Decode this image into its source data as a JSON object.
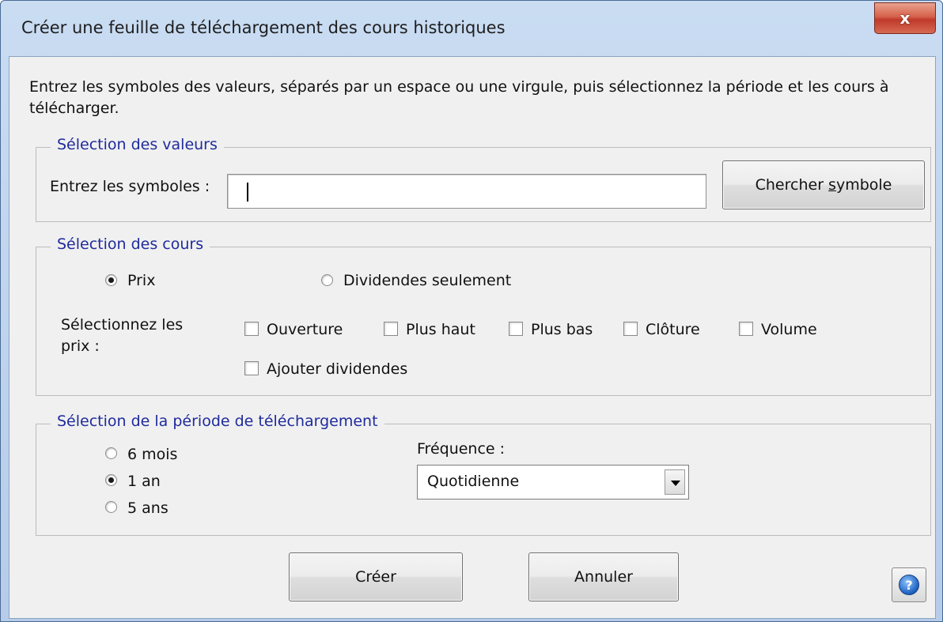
{
  "window": {
    "title": "Créer une feuille de téléchargement des cours historiques",
    "close_symbol": "x"
  },
  "instructions": {
    "line1": "Entrez les symboles des valeurs, séparés par un espace ou une virgule, puis sélectionnez la période et les cours à",
    "line2": "télécharger."
  },
  "securities_group": {
    "legend": "Sélection des valeurs",
    "symbols_label": "Entrez les symboles :",
    "symbols_value": "",
    "search_button_pre": "Chercher ",
    "search_button_accel": "s",
    "search_button_post": "ymbole"
  },
  "prices_group": {
    "legend": "Sélection des cours",
    "radio_prices": "Prix",
    "radio_dividends": "Dividendes seulement",
    "selected_mode": "Prix",
    "select_label_line1": "Sélectionnez les",
    "select_label_line2": "prix :",
    "checkboxes": [
      {
        "label": "Ouverture",
        "checked": false
      },
      {
        "label": "Plus haut",
        "checked": false
      },
      {
        "label": "Plus bas",
        "checked": false
      },
      {
        "label": "Clôture",
        "checked": false
      },
      {
        "label": "Volume",
        "checked": false
      },
      {
        "label": "Ajouter dividendes",
        "checked": false
      }
    ]
  },
  "period_group": {
    "legend": "Sélection de la période de téléchargement",
    "options": [
      "6 mois",
      "1 an",
      "5 ans"
    ],
    "selected": "1 an",
    "frequency_label": "Fréquence :",
    "frequency_value": "Quotidienne"
  },
  "buttons": {
    "create": "Créer",
    "cancel": "Annuler",
    "help_symbol": "?"
  },
  "icons": {
    "close": "close-icon",
    "dropdown": "chevron-down-icon",
    "help": "help-icon"
  },
  "colors": {
    "legend_text": "#1f2b9c",
    "close_button": "#c0392b",
    "dialog_background": "#f0f0f0"
  }
}
